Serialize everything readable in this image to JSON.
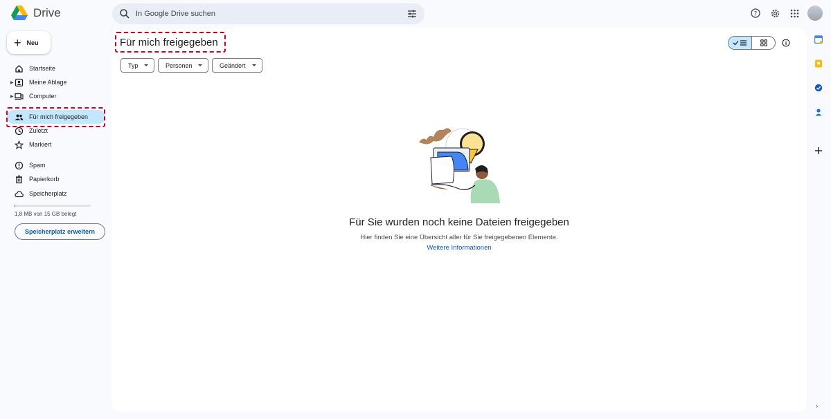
{
  "app": {
    "name": "Drive"
  },
  "search": {
    "placeholder": "In Google Drive suchen"
  },
  "new_button": {
    "label": "Neu"
  },
  "sidebar": {
    "items": [
      {
        "label": "Startseite"
      },
      {
        "label": "Meine Ablage"
      },
      {
        "label": "Computer"
      },
      {
        "label": "Für mich freigegeben"
      },
      {
        "label": "Zuletzt"
      },
      {
        "label": "Markiert"
      },
      {
        "label": "Spam"
      },
      {
        "label": "Papierkorb"
      },
      {
        "label": "Speicherplatz"
      }
    ],
    "storage_used_fraction": 0.0012,
    "storage_text": "1,8 MB von 15 GB belegt",
    "storage_button": "Speicherplatz erweitern"
  },
  "main": {
    "title": "Für mich freigegeben",
    "filters": [
      {
        "label": "Typ"
      },
      {
        "label": "Personen"
      },
      {
        "label": "Geändert"
      }
    ],
    "empty_title": "Für Sie wurden noch keine Dateien freigegeben",
    "empty_subtitle": "Hier finden Sie eine Übersicht aller für Sie freigegebenen Elemente.",
    "empty_link": "Weitere Informationen"
  },
  "colors": {
    "accent": "#0b57d0",
    "active_nav": "#c2e7ff",
    "highlight_dashed": "#d0021b"
  },
  "icons": {
    "top_bar": [
      "help-icon",
      "settings-icon",
      "apps-grid-icon"
    ],
    "right_rail": [
      "calendar-icon",
      "keep-icon",
      "tasks-icon",
      "contacts-icon",
      "add-icon"
    ]
  }
}
